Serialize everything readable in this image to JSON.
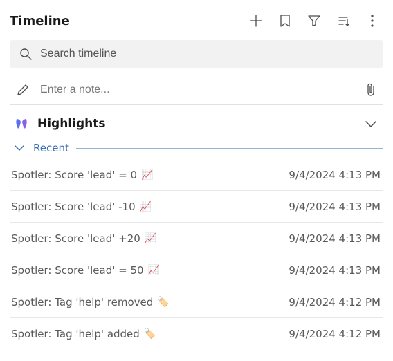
{
  "header": {
    "title": "Timeline"
  },
  "search": {
    "placeholder": "Search timeline"
  },
  "note": {
    "placeholder": "Enter a note..."
  },
  "highlights": {
    "label": "Highlights"
  },
  "section": {
    "label": "Recent"
  },
  "icons": {
    "add": "add-icon",
    "bookmark": "bookmark-icon",
    "filter": "filter-icon",
    "sort": "sort-icon",
    "more": "more-icon",
    "search": "search-icon",
    "pencil": "pencil-icon",
    "attach": "attachment-icon",
    "chevron_down": "chevron-down-icon",
    "copilot": "copilot-icon",
    "chart": "📈",
    "tag": "🏷️"
  },
  "items": [
    {
      "title": "Spotler: Score 'lead' = 0",
      "glyph": "📈",
      "time": "9/4/2024 4:13 PM"
    },
    {
      "title": "Spotler: Score 'lead' -10",
      "glyph": "📈",
      "time": "9/4/2024 4:13 PM"
    },
    {
      "title": "Spotler: Score 'lead' +20",
      "glyph": "📈",
      "time": "9/4/2024 4:13 PM"
    },
    {
      "title": "Spotler: Score 'lead' = 50",
      "glyph": "📈",
      "time": "9/4/2024 4:13 PM"
    },
    {
      "title": "Spotler: Tag 'help' removed",
      "glyph": "🏷️",
      "time": "9/4/2024 4:12 PM"
    },
    {
      "title": "Spotler: Tag 'help' added",
      "glyph": "🏷️",
      "time": "9/4/2024 4:12 PM"
    }
  ]
}
